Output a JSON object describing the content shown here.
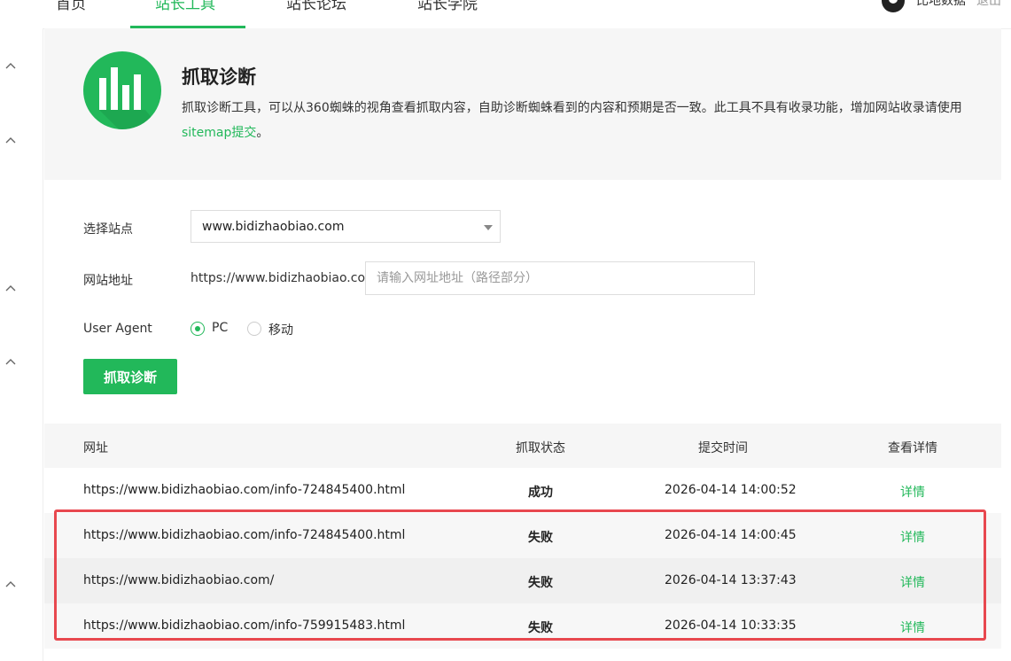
{
  "nav": {
    "items": [
      "首页",
      "站长工具",
      "站长论坛",
      "站长学院"
    ],
    "active_index": 1,
    "user_name": "比地数据",
    "logout": "退出"
  },
  "header": {
    "title": "抓取诊断",
    "description_prefix": "抓取诊断工具，可以从360蜘蛛的视角查看抓取内容，自助诊断蜘蛛看到的内容和预期是否一致。此工具不具有收录功能，增加网站收录请使用",
    "description_link": "sitemap提交",
    "description_suffix": "。"
  },
  "form": {
    "site_label": "选择站点",
    "site_value": "www.bidizhaobiao.com",
    "address_label": "网站地址",
    "address_prefix": "https://www.bidizhaobiao.com/",
    "address_placeholder": "请输入网址地址（路径部分）",
    "ua_label": "User Agent",
    "ua_options": [
      "PC",
      "移动"
    ],
    "ua_selected": "PC",
    "submit_label": "抓取诊断"
  },
  "table": {
    "headers": [
      "网址",
      "抓取状态",
      "提交时间",
      "查看详情"
    ],
    "rows": [
      {
        "url": "https://www.bidizhaobiao.com/info-724845400.html",
        "status": "成功",
        "time": "2026-04-14 14:00:52",
        "detail": "详情"
      },
      {
        "url": "https://www.bidizhaobiao.com/info-724845400.html",
        "status": "失败",
        "time": "2026-04-14 14:00:45",
        "detail": "详情"
      },
      {
        "url": "https://www.bidizhaobiao.com/",
        "status": "失败",
        "time": "2026-04-14 13:37:43",
        "detail": "详情"
      },
      {
        "url": "https://www.bidizhaobiao.com/info-759915483.html",
        "status": "失败",
        "time": "2026-04-14 10:33:35",
        "detail": "详情"
      }
    ]
  },
  "colors": {
    "accent": "#22b85a",
    "highlight": "#e8484f"
  }
}
